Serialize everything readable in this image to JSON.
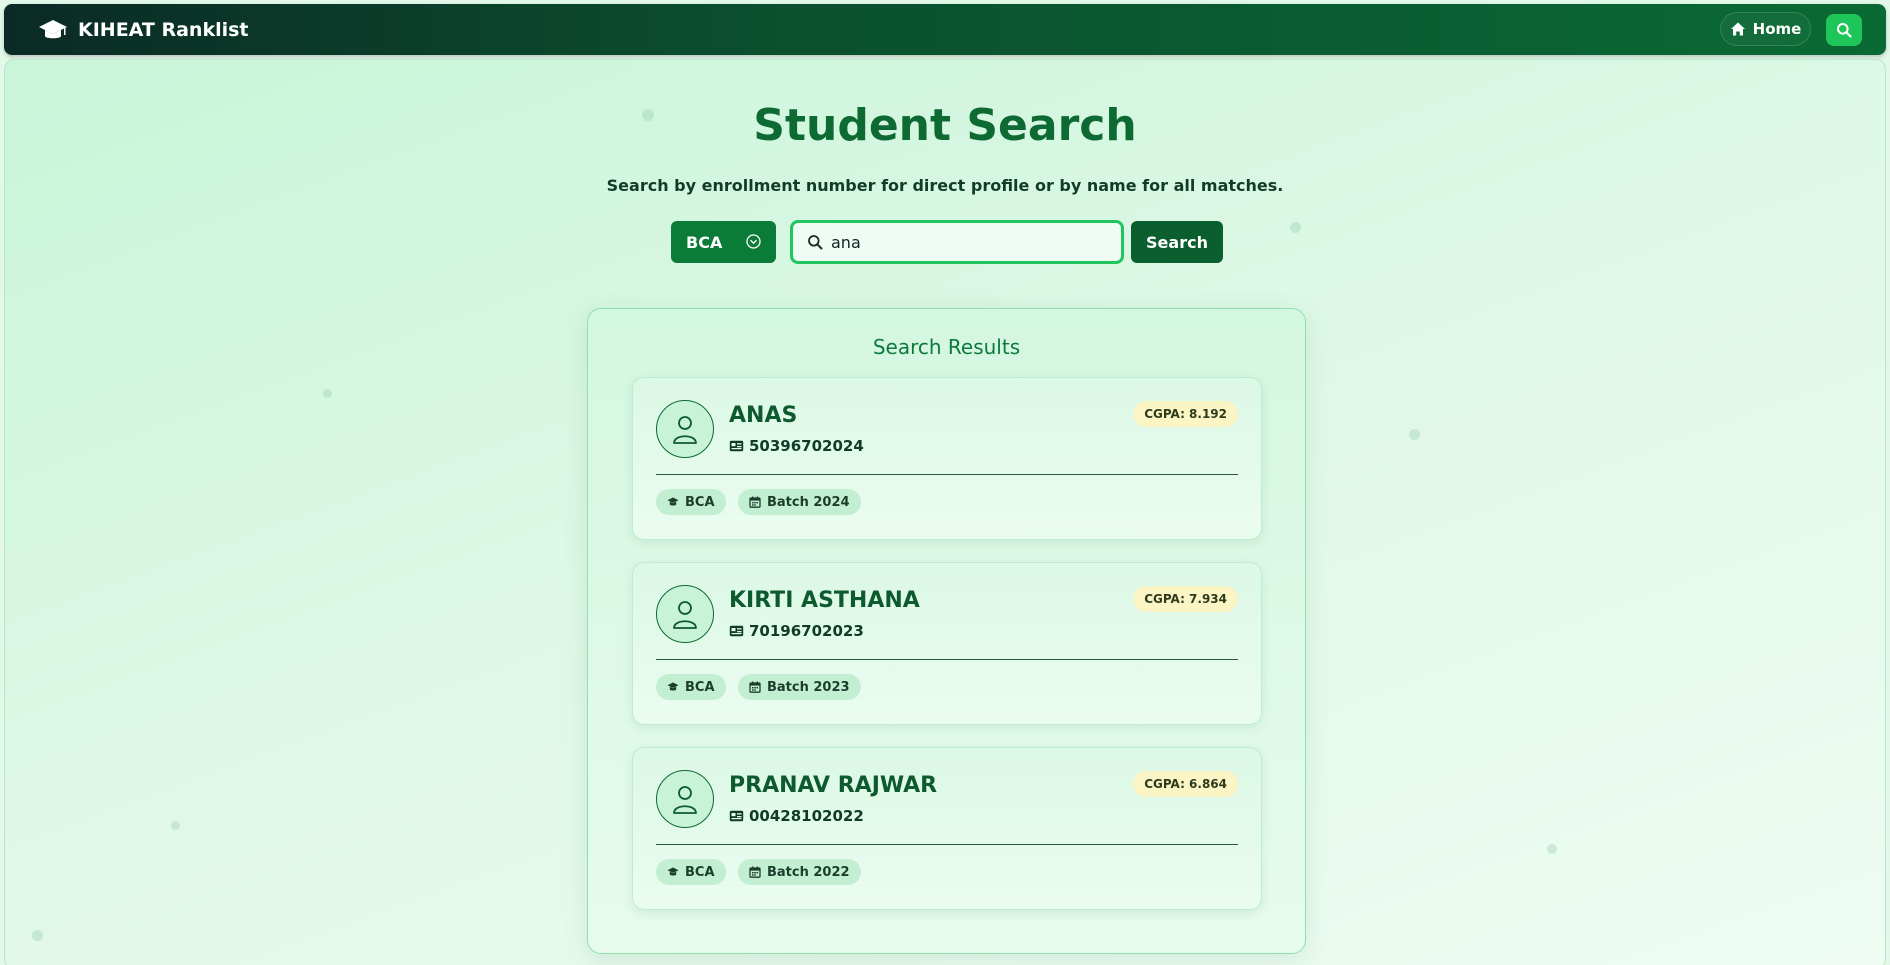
{
  "nav": {
    "brand": "KIHEAT Ranklist",
    "home_label": "Home"
  },
  "page": {
    "title": "Student Search",
    "subtitle": "Search by enrollment number for direct profile or by name for all matches."
  },
  "search": {
    "course_selected": "BCA",
    "query": "ana",
    "button_label": "Search"
  },
  "results": {
    "title": "Search Results",
    "items": [
      {
        "name": "ANAS",
        "enrollment": "50396702024",
        "cgpa": "CGPA: 8.192",
        "course": "BCA",
        "batch": "Batch 2024"
      },
      {
        "name": "KIRTI ASTHANA",
        "enrollment": "70196702023",
        "cgpa": "CGPA: 7.934",
        "course": "BCA",
        "batch": "Batch 2023"
      },
      {
        "name": "PRANAV RAJWAR",
        "enrollment": "00428102022",
        "cgpa": "CGPA: 6.864",
        "course": "BCA",
        "batch": "Batch 2022"
      }
    ]
  },
  "colors": {
    "primary": "#0d6a33",
    "accent": "#22c45e",
    "cgpa_badge": "#fbf5c5"
  },
  "icons": {
    "brand": "graduation-cap-icon",
    "home": "home-icon",
    "search": "search-icon",
    "dropdown": "chevron-circle-down-icon",
    "avatar": "user-icon",
    "enrollment": "id-card-icon",
    "course": "graduation-cap-icon",
    "batch": "calendar-icon"
  }
}
